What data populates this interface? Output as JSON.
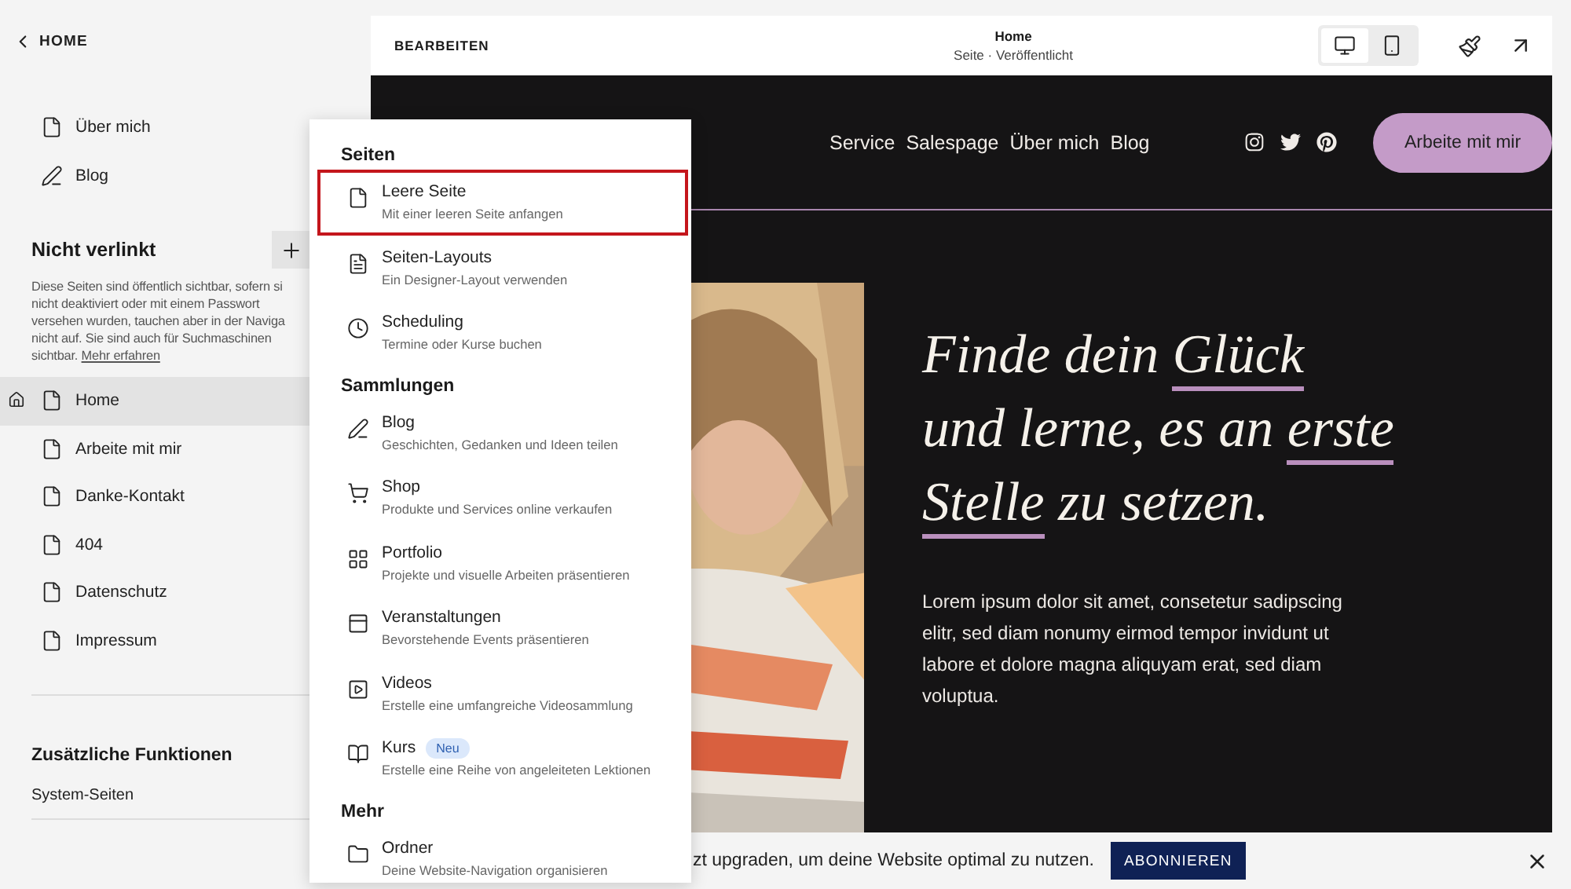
{
  "sidebar": {
    "back": "HOME",
    "linked_items": [
      {
        "label": "Über mich",
        "kind": "page"
      },
      {
        "label": "Blog",
        "kind": "blog"
      }
    ],
    "unlinked": {
      "title": "Nicht verlinkt",
      "info_lines": [
        "Diese Seiten sind öffentlich sichtbar, sofern si",
        "nicht deaktiviert oder mit einem Passwort",
        "versehen wurden, tauchen aber in der Naviga",
        "nicht auf. Sie sind auch für Suchmaschinen",
        "sichtbar."
      ],
      "info_link": "Mehr erfahren",
      "items": [
        {
          "label": "Home",
          "homepage": true,
          "selected": true
        },
        {
          "label": "Arbeite mit mir",
          "homepage": false,
          "selected": false
        },
        {
          "label": "Danke-Kontakt",
          "homepage": false,
          "selected": false
        },
        {
          "label": "404",
          "homepage": false,
          "selected": false
        },
        {
          "label": "Datenschutz",
          "homepage": false,
          "selected": false
        },
        {
          "label": "Impressum",
          "homepage": false,
          "selected": false
        }
      ]
    },
    "extras": {
      "title": "Zusätzliche Funktionen",
      "items": [
        "System-Seiten"
      ]
    }
  },
  "editor_header": {
    "mode": "BEARBEITEN",
    "page_title": "Home",
    "page_status": "Seite · Veröffentlicht",
    "devices": [
      {
        "kind": "desktop",
        "selected": true
      },
      {
        "kind": "mobile",
        "selected": false
      }
    ]
  },
  "site": {
    "nav": [
      "Service",
      "Salespage",
      "Über mich",
      "Blog"
    ],
    "socials": [
      {
        "kind": "instagram"
      },
      {
        "kind": "twitter"
      },
      {
        "kind": "pinterest"
      }
    ],
    "cta": "Arbeite mit mir",
    "headline_lines": [
      "Finde dein *Glück*",
      "und lerne, es an *erste*",
      "*Stelle* zu setzen."
    ],
    "body": "Lorem ipsum dolor sit amet, consetetur sadipscing elitr, sed diam nonumy eirmod tempor invidunt ut labore et dolore magna aliquyam erat, sed diam voluptua."
  },
  "add_menu": {
    "sections": [
      {
        "title": "Seiten",
        "items": [
          {
            "kind": "page",
            "title": "Leere Seite",
            "description": "Mit einer leeren Seite anfangen",
            "highlighted": true
          },
          {
            "kind": "layout",
            "title": "Seiten-Layouts",
            "description": "Ein Designer-Layout verwenden",
            "highlighted": false
          },
          {
            "kind": "scheduling",
            "title": "Scheduling",
            "description": "Termine oder Kurse buchen",
            "highlighted": false
          }
        ]
      },
      {
        "title": "Sammlungen",
        "items": [
          {
            "kind": "blog",
            "title": "Blog",
            "description": "Geschichten, Gedanken und Ideen teilen",
            "highlighted": false
          },
          {
            "kind": "shop",
            "title": "Shop",
            "description": "Produkte und Services online verkaufen",
            "highlighted": false
          },
          {
            "kind": "portfolio",
            "title": "Portfolio",
            "description": "Projekte und visuelle Arbeiten präsentieren",
            "highlighted": false
          },
          {
            "kind": "events",
            "title": "Veranstaltungen",
            "description": "Bevorstehende Events präsentieren",
            "highlighted": false
          },
          {
            "kind": "videos",
            "title": "Videos",
            "description": "Erstelle eine umfangreiche Videosammlung",
            "highlighted": false
          },
          {
            "kind": "course",
            "title": "Kurs",
            "badge": "Neu",
            "description": "Erstelle eine Reihe von angeleiteten Lektionen",
            "highlighted": false
          }
        ]
      },
      {
        "title": "Mehr",
        "items": [
          {
            "kind": "folder",
            "title": "Ordner",
            "description": "Deine Website-Navigation organisieren",
            "highlighted": false
          }
        ]
      }
    ]
  },
  "banner": {
    "text": "zt upgraden, um deine Website optimal zu nutzen.",
    "button": "ABONNIEREN"
  }
}
